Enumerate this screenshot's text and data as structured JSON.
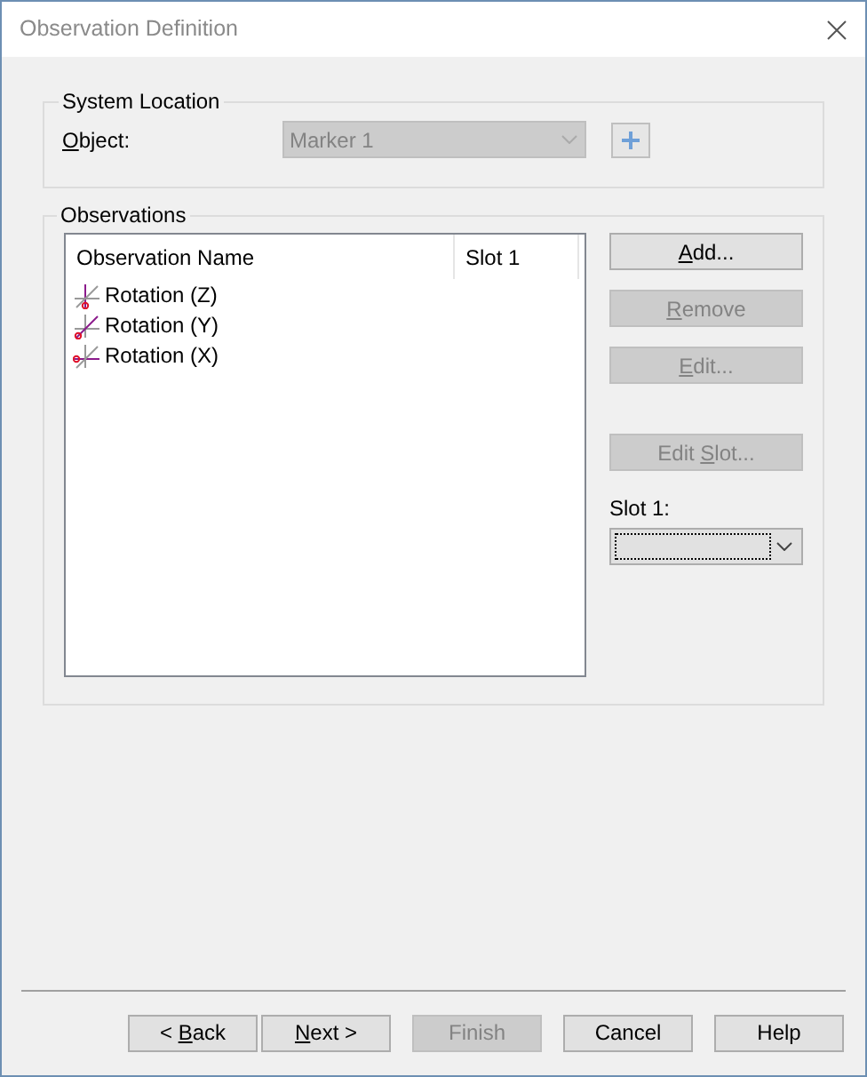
{
  "window": {
    "title": "Observation Definition"
  },
  "system_location": {
    "title": "System Location",
    "object_label": {
      "key": "O",
      "after": "bject:"
    },
    "object_value": "Marker 1",
    "object_disabled": true
  },
  "observations": {
    "title": "Observations",
    "columns": [
      "Observation Name",
      "Slot 1"
    ],
    "rows": [
      {
        "name": "Rotation (Z)",
        "kind": "z"
      },
      {
        "name": "Rotation (Y)",
        "kind": "y"
      },
      {
        "name": "Rotation (X)",
        "kind": "x"
      }
    ]
  },
  "side_buttons": [
    {
      "label": {
        "key": "A",
        "after": "dd..."
      },
      "disabled": false
    },
    {
      "label": {
        "key": "R",
        "after": "emove"
      },
      "disabled": true
    },
    {
      "label": {
        "key": "E",
        "after": "dit..."
      },
      "disabled": true
    },
    {
      "label": {
        "before": "Edit ",
        "key": "S",
        "after": "lot..."
      },
      "disabled": true
    }
  ],
  "slot": {
    "label": "Slot 1:"
  },
  "footer_buttons": [
    {
      "label": {
        "before": "< ",
        "key": "B",
        "after": "ack"
      },
      "disabled": false
    },
    {
      "label": {
        "key": "N",
        "after": "ext >"
      },
      "disabled": false
    },
    {
      "label": {
        "before": "Finish"
      },
      "disabled": true
    },
    {
      "label": {
        "before": "Cancel"
      },
      "disabled": false
    },
    {
      "label": {
        "before": "Help"
      },
      "disabled": false
    }
  ]
}
